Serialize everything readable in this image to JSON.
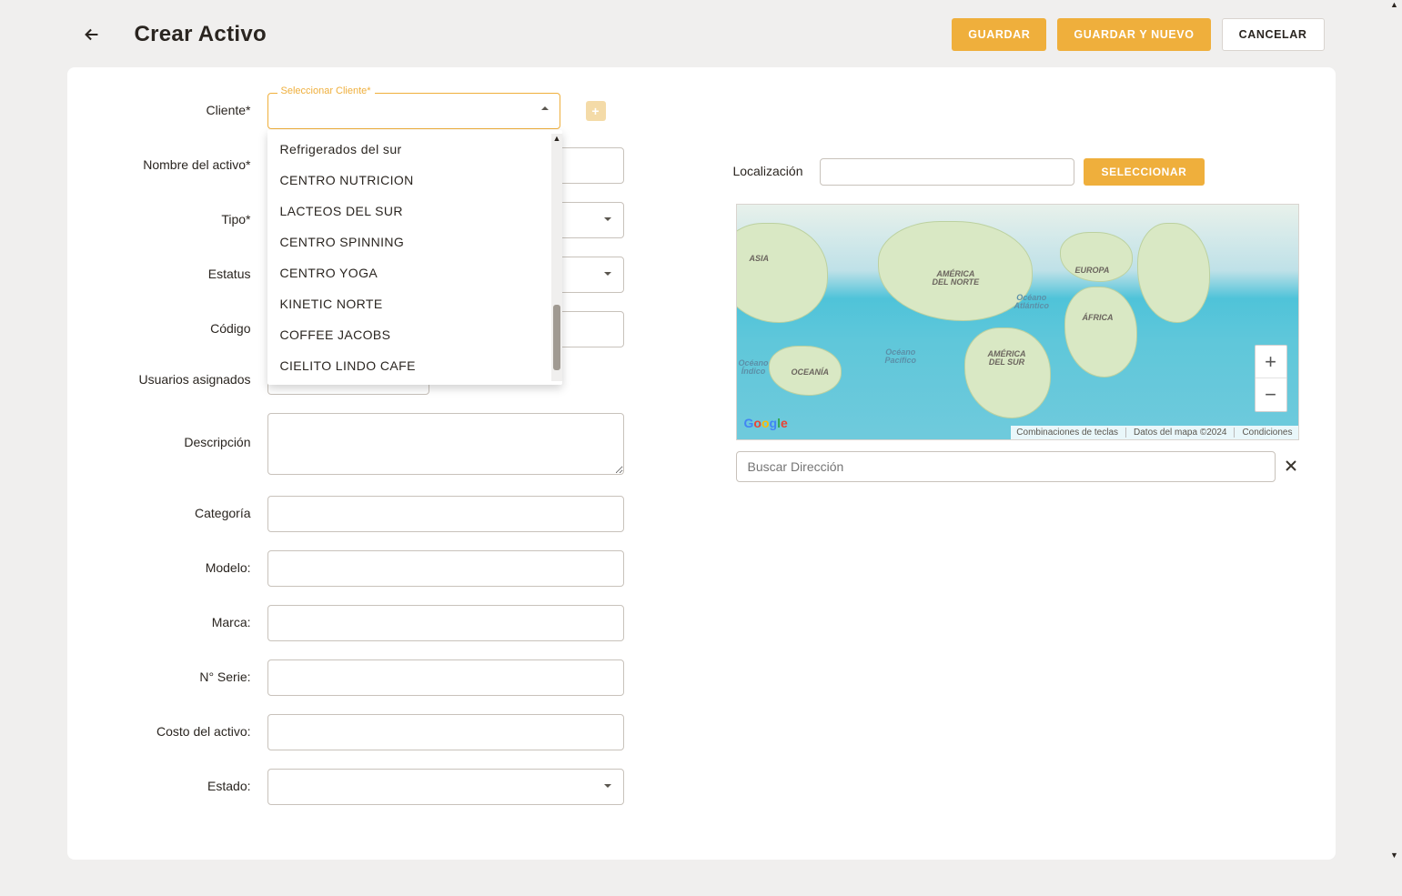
{
  "header": {
    "title": "Crear Activo",
    "actions": {
      "save": "GUARDAR",
      "save_new": "GUARDAR Y NUEVO",
      "cancel": "CANCELAR"
    }
  },
  "form": {
    "cliente": {
      "label": "Cliente*",
      "float": "Seleccionar Cliente*"
    },
    "nombre": {
      "label": "Nombre del activo*"
    },
    "tipo": {
      "label": "Tipo*"
    },
    "estatus": {
      "label": "Estatus"
    },
    "codigo": {
      "label": "Código"
    },
    "usuarios": {
      "label": "Usuarios asignados"
    },
    "descripcion": {
      "label": "Descripción"
    },
    "categoria": {
      "label": "Categoría"
    },
    "modelo": {
      "label": "Modelo:"
    },
    "marca": {
      "label": "Marca:"
    },
    "serie": {
      "label": "N° Serie:"
    },
    "costo": {
      "label": "Costo del activo:"
    },
    "estado": {
      "label": "Estado:"
    },
    "localizacion": {
      "label": "Localización",
      "button": "SELECCIONAR"
    },
    "buscar_placeholder": "Buscar Dirección"
  },
  "dropdown": {
    "options": [
      "Refrigerados del sur",
      "CENTRO NUTRICION",
      "LACTEOS DEL SUR",
      "CENTRO SPINNING",
      "CENTRO YOGA",
      "KINETIC NORTE",
      "COFFEE JACOBS",
      "CIELITO LINDO CAFE"
    ]
  },
  "map": {
    "labels": {
      "asia": "ASIA",
      "na": "AMÉRICA\nDEL NORTE",
      "sa": "AMÉRICA\nDEL SUR",
      "europa": "EUROPA",
      "africa": "ÁFRICA",
      "oceania": "OCEANÍA",
      "atlantico": "Océano\nAtlántico",
      "indico": "Océano\nÍndico",
      "pacifico": "Océano\nPacífico"
    },
    "footer": {
      "keys": "Combinaciones de teclas",
      "data": "Datos del mapa ©2024",
      "terms": "Condiciones"
    },
    "logo": "Google"
  }
}
